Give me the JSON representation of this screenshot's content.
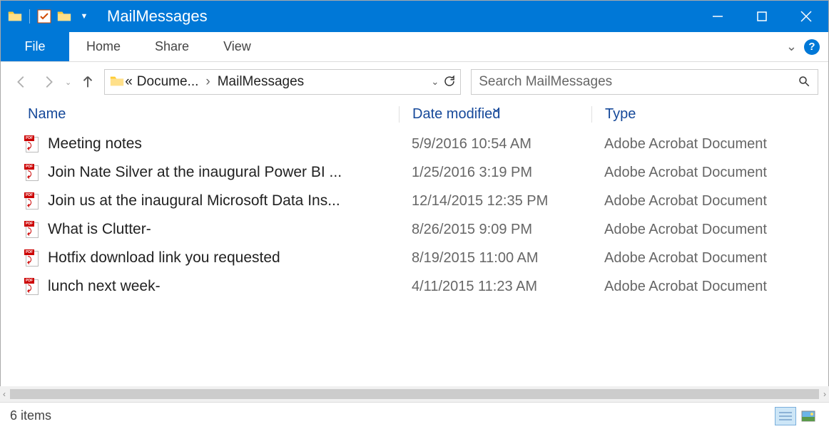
{
  "window": {
    "title": "MailMessages"
  },
  "tabs": {
    "file": "File",
    "home": "Home",
    "share": "Share",
    "view": "View"
  },
  "breadcrumbs": {
    "ellipsis": "«",
    "items": [
      "Docume...",
      "MailMessages"
    ]
  },
  "search": {
    "placeholder": "Search MailMessages"
  },
  "columns": {
    "name": "Name",
    "date": "Date modified",
    "type": "Type"
  },
  "files": [
    {
      "name": "Meeting notes",
      "date": "5/9/2016 10:54 AM",
      "type": "Adobe Acrobat Document"
    },
    {
      "name": "Join Nate Silver at the inaugural Power BI ...",
      "date": "1/25/2016 3:19 PM",
      "type": "Adobe Acrobat Document"
    },
    {
      "name": "Join us at the inaugural Microsoft Data Ins...",
      "date": "12/14/2015 12:35 PM",
      "type": "Adobe Acrobat Document"
    },
    {
      "name": "What is Clutter-",
      "date": "8/26/2015 9:09 PM",
      "type": "Adobe Acrobat Document"
    },
    {
      "name": "Hotfix download link you requested",
      "date": "8/19/2015 11:00 AM",
      "type": "Adobe Acrobat Document"
    },
    {
      "name": "lunch next week-",
      "date": "4/11/2015 11:23 AM",
      "type": "Adobe Acrobat Document"
    }
  ],
  "status": {
    "count": "6 items"
  }
}
